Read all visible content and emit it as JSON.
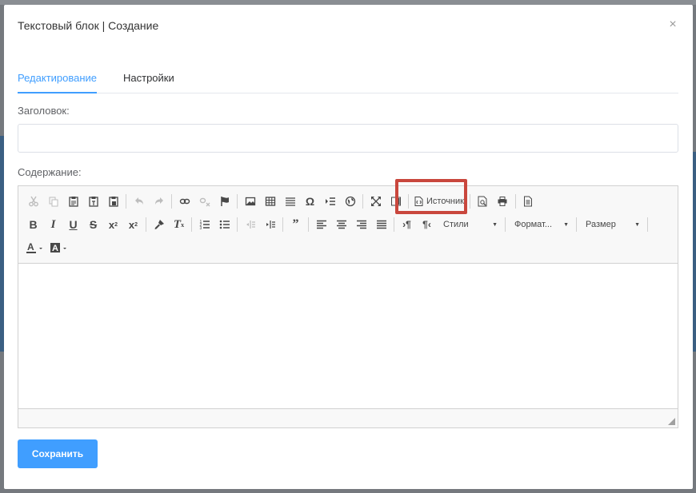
{
  "dialog": {
    "title": "Текстовый блок | Создание",
    "close_symbol": "×"
  },
  "tabs": [
    {
      "label": "Редактирование",
      "active": true
    },
    {
      "label": "Настройки",
      "active": false
    }
  ],
  "form": {
    "title_label": "Заголовок:",
    "title_value": "",
    "content_label": "Содержание:"
  },
  "toolbar": {
    "source_label": "Источник",
    "styles_label": "Стили",
    "format_label": "Формат...",
    "size_label": "Размер",
    "icons_row1": [
      "cut-icon",
      "copy-icon",
      "paste-icon",
      "paste-text-icon",
      "paste-word-icon",
      "undo-icon",
      "redo-icon",
      "link-icon",
      "unlink-icon",
      "anchor-icon",
      "image-icon",
      "table-icon",
      "horizontal-line-icon",
      "special-char-icon",
      "page-break-icon",
      "iframe-icon",
      "maximize-icon",
      "show-blocks-icon",
      "source-icon",
      "preview-icon",
      "print-icon",
      "templates-icon"
    ],
    "icons_row2": [
      "bold-icon",
      "italic-icon",
      "underline-icon",
      "strike-icon",
      "subscript-icon",
      "superscript-icon",
      "copy-format-icon",
      "remove-format-icon",
      "numbered-list-icon",
      "bulleted-list-icon",
      "outdent-icon",
      "indent-icon",
      "blockquote-icon",
      "align-left-icon",
      "align-center-icon",
      "align-right-icon",
      "justify-icon",
      "ltr-icon",
      "rtl-icon"
    ],
    "icons_row3": [
      "text-color-icon",
      "bg-color-icon"
    ]
  },
  "buttons": {
    "save_label": "Сохранить"
  },
  "colors": {
    "accent": "#409eff",
    "highlight": "#c9473d"
  }
}
